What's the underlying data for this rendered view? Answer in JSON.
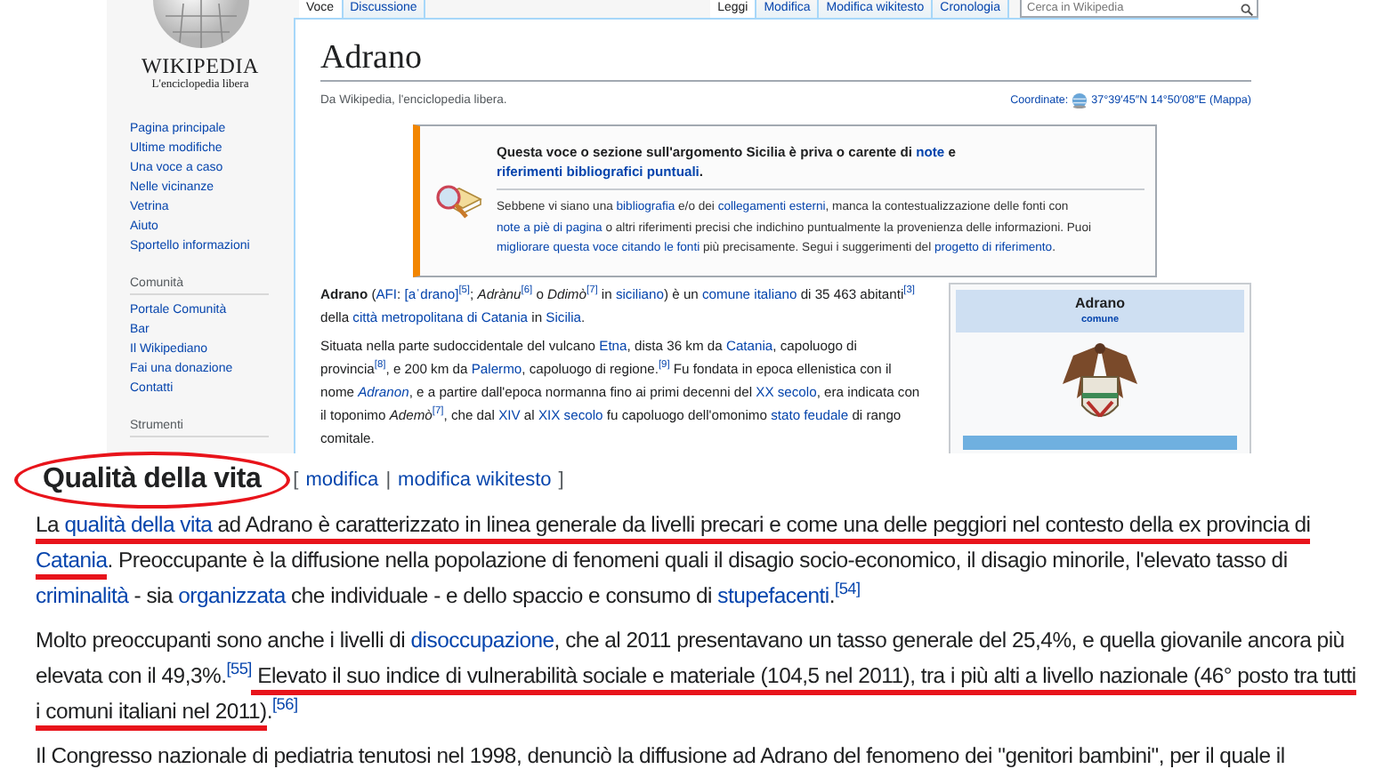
{
  "sidebar": {
    "logo_wordmark": "WIKIPEDIA",
    "logo_tagline": "L'enciclopedia libera",
    "nav": [
      "Pagina principale",
      "Ultime modifiche",
      "Una voce a caso",
      "Nelle vicinanze",
      "Vetrina",
      "Aiuto",
      "Sportello informazioni"
    ],
    "portals": [
      {
        "heading": "Comunità",
        "items": [
          "Portale Comunità",
          "Bar",
          "Il Wikipediano",
          "Fai una donazione",
          "Contatti"
        ]
      },
      {
        "heading": "Strumenti"
      }
    ]
  },
  "tabs_left": [
    {
      "label": "Voce",
      "selected": true
    },
    {
      "label": "Discussione",
      "selected": false
    }
  ],
  "tabs_right": [
    {
      "label": "Leggi",
      "selected": true
    },
    {
      "label": "Modifica",
      "selected": false
    },
    {
      "label": "Modifica wikitesto",
      "selected": false
    },
    {
      "label": "Cronologia",
      "selected": false
    }
  ],
  "search": {
    "placeholder": "Cerca in Wikipedia"
  },
  "page": {
    "title": "Adrano",
    "tagline": "Da Wikipedia, l'enciclopedia libera.",
    "coordinates": {
      "label": "Coordinate:",
      "value": "37°39′45″N 14°50′08″E",
      "map_link": "(Mappa)"
    }
  },
  "notice": {
    "title": [
      {
        "text": "Questa voce o sezione sull'argomento Sicilia è priva o carente di ",
        "kind": "text"
      },
      {
        "text": "note",
        "kind": "link"
      },
      {
        "text": " e ",
        "kind": "text"
      },
      {
        "text": "riferimenti bibliografici puntuali",
        "kind": "link"
      },
      {
        "text": ".",
        "kind": "text"
      }
    ],
    "body": [
      {
        "text": "Sebbene vi siano una ",
        "kind": "text"
      },
      {
        "text": "bibliografia",
        "kind": "link"
      },
      {
        "text": " e/o dei ",
        "kind": "text"
      },
      {
        "text": "collegamenti esterni",
        "kind": "link"
      },
      {
        "text": ", manca la contestualizzazione delle fonti con ",
        "kind": "text"
      },
      {
        "text": "note a piè di pagina",
        "kind": "link"
      },
      {
        "text": " o altri riferimenti precisi che indichino puntualmente la provenienza delle informazioni. Puoi ",
        "kind": "text"
      },
      {
        "text": "migliorare questa voce citando le fonti",
        "kind": "link"
      },
      {
        "text": " più precisamente. Segui i suggerimenti del ",
        "kind": "text"
      },
      {
        "text": "progetto di riferimento",
        "kind": "link"
      },
      {
        "text": ".",
        "kind": "text"
      }
    ]
  },
  "intro": [
    {
      "runs": [
        {
          "text": "Adrano",
          "kind": "bold"
        },
        {
          "text": " (",
          "kind": "text"
        },
        {
          "text": "AFI",
          "kind": "link"
        },
        {
          "text": ": ",
          "kind": "text"
        },
        {
          "text": "[aˈdrano]",
          "kind": "link"
        },
        {
          "text": "[5]",
          "kind": "ref"
        },
        {
          "text": "; ",
          "kind": "text"
        },
        {
          "text": "Adrànu",
          "kind": "italic"
        },
        {
          "text": "[6]",
          "kind": "ref"
        },
        {
          "text": " o ",
          "kind": "text"
        },
        {
          "text": "Ddimò",
          "kind": "italic"
        },
        {
          "text": "[7]",
          "kind": "ref"
        },
        {
          "text": " in ",
          "kind": "text"
        },
        {
          "text": "siciliano",
          "kind": "link"
        },
        {
          "text": ") è un ",
          "kind": "text"
        },
        {
          "text": "comune italiano",
          "kind": "link"
        },
        {
          "text": " di 35 463 abitanti",
          "kind": "text"
        },
        {
          "text": "[3]",
          "kind": "ref"
        },
        {
          "text": " della ",
          "kind": "text"
        },
        {
          "text": "città metropolitana di Catania",
          "kind": "link"
        },
        {
          "text": " in ",
          "kind": "text"
        },
        {
          "text": "Sicilia",
          "kind": "link"
        },
        {
          "text": ".",
          "kind": "text"
        }
      ]
    },
    {
      "runs": [
        {
          "text": "Situata nella parte sudoccidentale del vulcano ",
          "kind": "text"
        },
        {
          "text": "Etna",
          "kind": "link"
        },
        {
          "text": ", dista 36 km da ",
          "kind": "text"
        },
        {
          "text": "Catania",
          "kind": "link"
        },
        {
          "text": ", capoluogo di provincia",
          "kind": "text"
        },
        {
          "text": "[8]",
          "kind": "ref"
        },
        {
          "text": ", e 200 km da ",
          "kind": "text"
        },
        {
          "text": "Palermo",
          "kind": "link"
        },
        {
          "text": ", capoluogo di regione.",
          "kind": "text"
        },
        {
          "text": "[9]",
          "kind": "ref"
        },
        {
          "text": " Fu fondata in epoca ellenistica con il nome ",
          "kind": "text"
        },
        {
          "text": "Adranon",
          "kind": "italic_link"
        },
        {
          "text": ", e a partire dall'epoca normanna fino ai primi decenni del ",
          "kind": "text"
        },
        {
          "text": "XX secolo",
          "kind": "link"
        },
        {
          "text": ", era indicata con il toponimo ",
          "kind": "text"
        },
        {
          "text": "Ademò",
          "kind": "italic"
        },
        {
          "text": "[7]",
          "kind": "ref"
        },
        {
          "text": ", che dal ",
          "kind": "text"
        },
        {
          "text": "XIV",
          "kind": "link"
        },
        {
          "text": " al ",
          "kind": "text"
        },
        {
          "text": "XIX secolo",
          "kind": "link"
        },
        {
          "text": " fu capoluogo dell'omonimo ",
          "kind": "text"
        },
        {
          "text": "stato feudale",
          "kind": "link"
        },
        {
          "text": " di rango comitale.",
          "kind": "text"
        }
      ]
    }
  ],
  "infobox": {
    "title": "Adrano",
    "subtitle": "comune"
  },
  "section": {
    "heading": "Qualità della vita",
    "circled": true,
    "edit_open": "[",
    "edit_links": [
      "modifica",
      "modifica wikitesto"
    ],
    "edit_separator": "|",
    "edit_close": "]",
    "paragraphs": [
      {
        "runs": [
          {
            "text": "La ",
            "kind": "text",
            "underlined": true
          },
          {
            "text": "qualità della vita",
            "kind": "link",
            "underlined": true
          },
          {
            "text": " ad Adrano è caratterizzato in linea generale da livelli precari e come una delle peggiori nel contesto della ex provincia di ",
            "kind": "text",
            "underlined": true
          },
          {
            "text": "Catania",
            "kind": "link",
            "underlined": true
          },
          {
            "text": ". Preoccupante è la diffusione nella popolazione di fenomeni quali il disagio socio-economico, il disagio minorile, l'elevato tasso di ",
            "kind": "text",
            "underlined": false
          },
          {
            "text": "criminalità",
            "kind": "link",
            "underlined": false
          },
          {
            "text": " - sia ",
            "kind": "text",
            "underlined": false
          },
          {
            "text": "organizzata",
            "kind": "link",
            "underlined": false
          },
          {
            "text": " che individuale - e dello spaccio e consumo di ",
            "kind": "text",
            "underlined": false
          },
          {
            "text": "stupefacenti",
            "kind": "link",
            "underlined": false
          },
          {
            "text": ".",
            "kind": "text",
            "underlined": false
          },
          {
            "text": "[54]",
            "kind": "ref",
            "underlined": false
          }
        ]
      },
      {
        "runs": [
          {
            "text": "Molto preoccupanti sono anche i livelli di ",
            "kind": "text",
            "underlined": false
          },
          {
            "text": "disoccupazione",
            "kind": "link",
            "underlined": false
          },
          {
            "text": ", che al 2011 presentavano un tasso generale del 25,4%, e quella giovanile ancora più elevata con il 49,3%.",
            "kind": "text",
            "underlined": false
          },
          {
            "text": "[55]",
            "kind": "ref",
            "underlined": false
          },
          {
            "text": " Elevato il suo indice di vulnerabilità sociale e materiale (104,5 nel 2011), tra i più alti a livello nazionale (46° posto tra tutti i comuni italiani nel 2011)",
            "kind": "text",
            "underlined": true
          },
          {
            "text": ".",
            "kind": "text",
            "underlined": false
          },
          {
            "text": "[56]",
            "kind": "ref",
            "underlined": false
          }
        ]
      },
      {
        "runs": [
          {
            "text": "Il Congresso nazionale di pediatria tenutosi nel 1998, denunciò la diffusione ad Adrano del fenomeno dei \"genitori bambini\", per il quale il",
            "kind": "text",
            "underlined": false
          }
        ]
      }
    ]
  }
}
